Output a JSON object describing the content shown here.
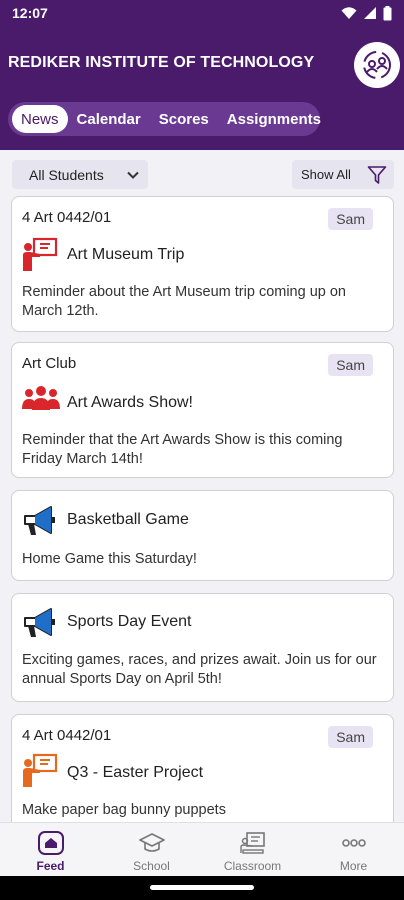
{
  "status": {
    "time": "12:07"
  },
  "header": {
    "title": "REDIKER INSTITUTE OF TECHNOLOGY",
    "tabs": [
      {
        "label": "News"
      },
      {
        "label": "Calendar"
      },
      {
        "label": "Scores"
      },
      {
        "label": "Assignments"
      }
    ]
  },
  "filters": {
    "students": "All Students",
    "show_all": "Show All"
  },
  "feed": [
    {
      "class": "4 Art 0442/01",
      "badge": "Sam",
      "icon": "teacher-icon",
      "title": "Art Museum Trip",
      "body": "Reminder about the Art Museum trip coming up on March 12th."
    },
    {
      "class": "Art Club",
      "badge": "Sam",
      "icon": "group-icon",
      "title": "Art Awards Show!",
      "body": "Reminder that the Art Awards Show is this coming Friday March 14th!"
    },
    {
      "class": "",
      "badge": "",
      "icon": "megaphone-icon",
      "title": "Basketball Game",
      "body": "Home Game this Saturday!"
    },
    {
      "class": "",
      "badge": "",
      "icon": "megaphone-icon",
      "title": "Sports Day Event",
      "body": "Exciting games, races, and prizes await. Join us for our annual Sports Day on April 5th!"
    },
    {
      "class": "4 Art 0442/01",
      "badge": "Sam",
      "icon": "teacher-icon",
      "title": "Q3 - Easter Project",
      "body": "Make paper bag bunny puppets"
    }
  ],
  "nav": [
    {
      "label": "Feed",
      "icon": "feed-icon"
    },
    {
      "label": "School",
      "icon": "school-icon"
    },
    {
      "label": "Classroom",
      "icon": "classroom-icon"
    },
    {
      "label": "More",
      "icon": "more-icon"
    }
  ],
  "colors": {
    "brand": "#4a1a6b",
    "accent_red": "#d8262c",
    "accent_orange": "#e66a1e",
    "megaphone_blue": "#1f6fc9"
  }
}
